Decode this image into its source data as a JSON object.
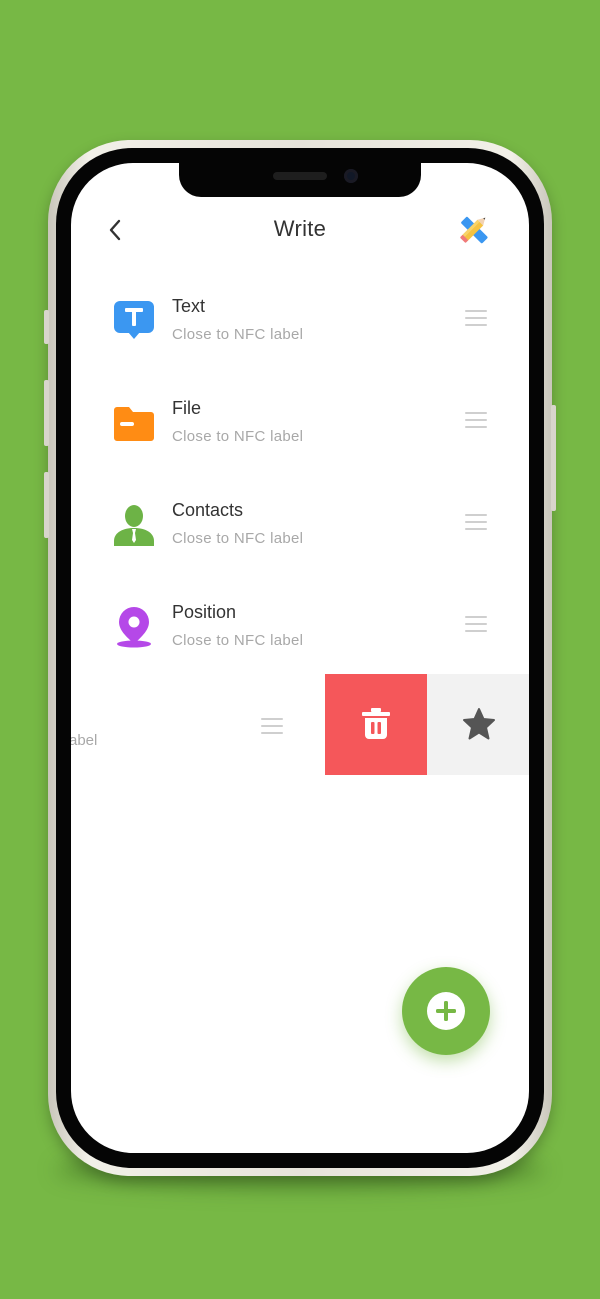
{
  "colors": {
    "background": "#77b845",
    "accent": "#77b845",
    "delete": "#f5575a",
    "text_icon": "#3b97f1",
    "file_icon": "#ff8c14",
    "contacts_icon": "#6db346",
    "position_icon": "#b548e8"
  },
  "header": {
    "title": "Write",
    "back_icon": "chevron-left-icon",
    "edit_icon": "pencil-ruler-icon"
  },
  "items": [
    {
      "title": "Text",
      "subtitle": "Close to NFC label",
      "icon": "text-bubble-icon"
    },
    {
      "title": "File",
      "subtitle": "Close to NFC label",
      "icon": "folder-icon"
    },
    {
      "title": "Contacts",
      "subtitle": "Close to NFC label",
      "icon": "person-icon"
    },
    {
      "title": "Position",
      "subtitle": "Close to NFC label",
      "icon": "location-pin-icon"
    }
  ],
  "swiped_item": {
    "subtitle_fragment": "abel",
    "actions": [
      "trash-icon",
      "star-icon"
    ]
  },
  "fab": {
    "icon": "plus-circle-icon"
  }
}
